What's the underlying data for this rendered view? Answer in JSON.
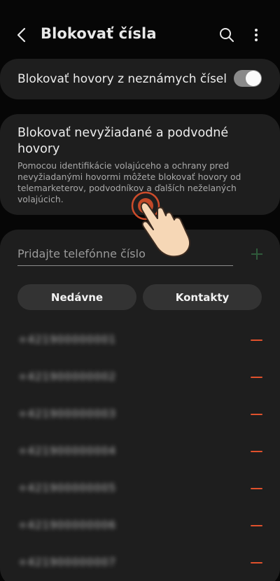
{
  "header": {
    "title": "Blokovať čísla",
    "back_icon": "chevron-left-icon",
    "search_icon": "search-icon",
    "more_icon": "more-vertical-icon"
  },
  "unknown_setting": {
    "label": "Blokovať hovory z neznámych čísel",
    "enabled": true
  },
  "spam_setting": {
    "title": "Blokovať nevyžiadané a podvodné hovory",
    "description": "Pomocou identifikácie volajúceho a ochrany pred nevyžiadanými hovormi môžete blokovať hovory od telemarketerov, podvodníkov a ďalších neželaných volajúcich."
  },
  "add_number": {
    "placeholder": "Pridajte telefónne číslo",
    "value": ""
  },
  "buttons": {
    "recent": "Nedávne",
    "contacts": "Kontakty"
  },
  "blocked_numbers": [
    "+421900000001",
    "+421900000002",
    "+421900000003",
    "+421900000004",
    "+421900000005",
    "+421900000006",
    "+421900000007"
  ],
  "colors": {
    "remove": "#e0512c",
    "tap_ring": "#e0512c",
    "card": "#1e1e1e"
  }
}
